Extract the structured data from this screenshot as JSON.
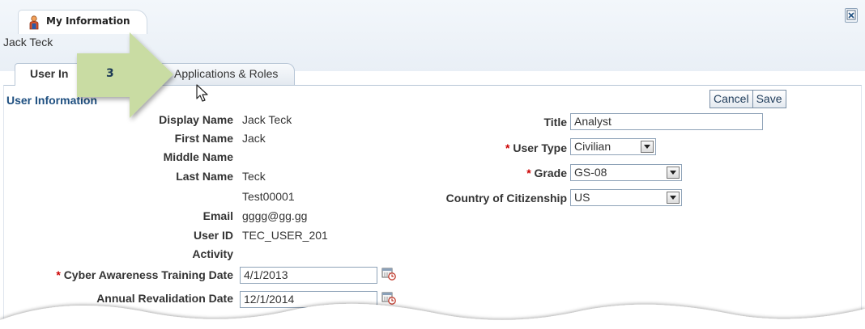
{
  "page": {
    "tab_title": "My Information",
    "user_display": "Jack Teck"
  },
  "tabs": [
    {
      "label": "User Information",
      "visible_label": "User In",
      "active": true
    },
    {
      "label": "Applications & Roles",
      "active": false
    }
  ],
  "section": {
    "title": "User Information"
  },
  "actions": {
    "cancel_label": "Cancel",
    "save_label": "Save"
  },
  "left_fields": {
    "display_name": {
      "label": "Display Name",
      "value": "Jack Teck"
    },
    "first_name": {
      "label": "First Name",
      "value": "Jack"
    },
    "middle_name": {
      "label": "Middle Name",
      "value": ""
    },
    "last_name": {
      "label": "Last Name",
      "value": "Teck"
    },
    "extra_line": {
      "value": "Test00001"
    },
    "email": {
      "label": "Email",
      "value": "gggg@gg.gg"
    },
    "user_id": {
      "label": "User ID",
      "value": "TEC_USER_201"
    },
    "activity": {
      "label": "Activity",
      "value": ""
    },
    "cyber_date": {
      "required_mark": "*",
      "label": "Cyber Awareness Training Date",
      "value": "4/1/2013"
    },
    "revalidation_date": {
      "label": "Annual Revalidation Date",
      "value": "12/1/2014"
    }
  },
  "right_fields": {
    "title": {
      "label": "Title",
      "value": "Analyst"
    },
    "user_type": {
      "required_mark": "*",
      "label": "User Type",
      "value": "Civilian"
    },
    "grade": {
      "required_mark": "*",
      "label": "Grade",
      "value": "GS-08"
    },
    "citizenship": {
      "label": "Country of Citizenship",
      "value": "US"
    }
  },
  "callout": {
    "number": "3"
  },
  "icons": {
    "user": "user-icon",
    "close": "close-window-icon",
    "calendar": "calendar-icon",
    "dropdown": "chevron-down-icon",
    "cursor": "mouse-pointer-icon"
  },
  "colors": {
    "section_title": "#1e4f80",
    "required": "#cc0000",
    "callout_arrow": "#c9dca3",
    "header_band": "#eef3f8"
  }
}
